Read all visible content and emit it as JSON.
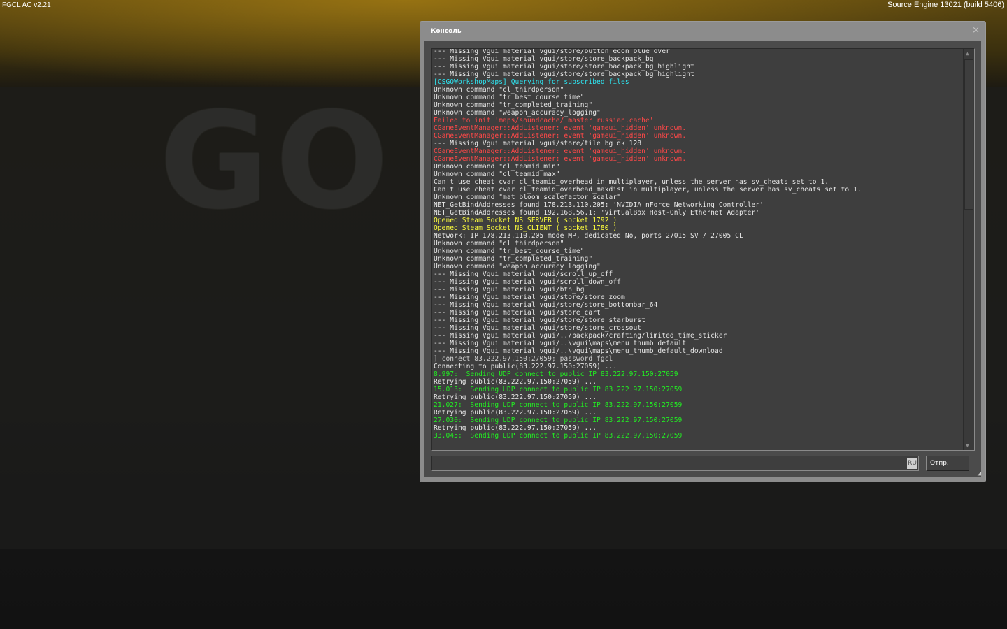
{
  "overlay": {
    "left": "FGCL AC v2.21",
    "right": "Source Engine 13021 (build 5406)",
    "logo": "GO"
  },
  "console": {
    "title": "Консоль",
    "close_icon": "×",
    "send_label": "Отпр.",
    "lang": "RU",
    "input_value": "",
    "colors": {
      "normal": "#e6e6e6",
      "cyan": "#2ee6f2",
      "red": "#ff4848",
      "yellow": "#ffff3c",
      "green": "#22ee22",
      "echo": "#cfcfcf"
    },
    "lines": [
      {
        "t": "--- Missing Vgui material vgui/store/button_econ_blue_over",
        "c": "normal"
      },
      {
        "t": "--- Missing Vgui material vgui/store/store_backpack_bg",
        "c": "normal"
      },
      {
        "t": "--- Missing Vgui material vgui/store/store_backpack_bg_highlight",
        "c": "normal"
      },
      {
        "t": "--- Missing Vgui material vgui/store/store_backpack_bg_highlight",
        "c": "normal"
      },
      {
        "t": "[CSGOWorkshopMaps] Querying for subscribed files",
        "c": "cyan"
      },
      {
        "t": "Unknown command \"cl_thirdperson\"",
        "c": "normal"
      },
      {
        "t": "Unknown command \"tr_best_course_time\"",
        "c": "normal"
      },
      {
        "t": "Unknown command \"tr_completed_training\"",
        "c": "normal"
      },
      {
        "t": "Unknown command \"weapon_accuracy_logging\"",
        "c": "normal"
      },
      {
        "t": "Failed to init 'maps/soundcache/_master_russian.cache'",
        "c": "red"
      },
      {
        "t": "CGameEventManager::AddListener: event 'gameui_hidden' unknown.",
        "c": "red"
      },
      {
        "t": "CGameEventManager::AddListener: event 'gameui_hidden' unknown.",
        "c": "red"
      },
      {
        "t": "--- Missing Vgui material vgui/store/tile_bg_dk_128",
        "c": "normal"
      },
      {
        "t": "CGameEventManager::AddListener: event 'gameui_hidden' unknown.",
        "c": "red"
      },
      {
        "t": "CGameEventManager::AddListener: event 'gameui_hidden' unknown.",
        "c": "red"
      },
      {
        "t": "Unknown command \"cl_teamid_min\"",
        "c": "normal"
      },
      {
        "t": "Unknown command \"cl_teamid_max\"",
        "c": "normal"
      },
      {
        "t": "Can't use cheat cvar cl_teamid_overhead in multiplayer, unless the server has sv_cheats set to 1.",
        "c": "normal"
      },
      {
        "t": "Can't use cheat cvar cl_teamid_overhead_maxdist in multiplayer, unless the server has sv_cheats set to 1.",
        "c": "normal"
      },
      {
        "t": "Unknown command \"mat_bloom_scalefactor_scalar\"",
        "c": "normal"
      },
      {
        "t": "NET_GetBindAddresses found 178.213.110.205: 'NVIDIA nForce Networking Controller'",
        "c": "normal"
      },
      {
        "t": "NET_GetBindAddresses found 192.168.56.1: 'VirtualBox Host-Only Ethernet Adapter'",
        "c": "normal"
      },
      {
        "t": "Opened Steam Socket NS_SERVER ( socket 1792 )",
        "c": "yellow"
      },
      {
        "t": "Opened Steam Socket NS_CLIENT ( socket 1780 )",
        "c": "yellow"
      },
      {
        "t": "Network: IP 178.213.110.205 mode MP, dedicated No, ports 27015 SV / 27005 CL",
        "c": "normal"
      },
      {
        "t": "Unknown command \"cl_thirdperson\"",
        "c": "normal"
      },
      {
        "t": "Unknown command \"tr_best_course_time\"",
        "c": "normal"
      },
      {
        "t": "Unknown command \"tr_completed_training\"",
        "c": "normal"
      },
      {
        "t": "Unknown command \"weapon_accuracy_logging\"",
        "c": "normal"
      },
      {
        "t": "--- Missing Vgui material vgui/scroll_up_off",
        "c": "normal"
      },
      {
        "t": "--- Missing Vgui material vgui/scroll_down_off",
        "c": "normal"
      },
      {
        "t": "--- Missing Vgui material vgui/btn_bg",
        "c": "normal"
      },
      {
        "t": "--- Missing Vgui material vgui/store/store_zoom",
        "c": "normal"
      },
      {
        "t": "--- Missing Vgui material vgui/store/store_bottombar_64",
        "c": "normal"
      },
      {
        "t": "--- Missing Vgui material vgui/store_cart",
        "c": "normal"
      },
      {
        "t": "--- Missing Vgui material vgui/store/store_starburst",
        "c": "normal"
      },
      {
        "t": "--- Missing Vgui material vgui/store/store_crossout",
        "c": "normal"
      },
      {
        "t": "--- Missing Vgui material vgui/../backpack/crafting/limited_time_sticker",
        "c": "normal"
      },
      {
        "t": "--- Missing Vgui material vgui/..\\vgui\\maps\\menu_thumb_default",
        "c": "normal"
      },
      {
        "t": "--- Missing Vgui material vgui/..\\vgui\\maps\\menu_thumb_default_download",
        "c": "normal"
      },
      {
        "t": "] connect 83.222.97.150:27059; password fgcl",
        "c": "echo"
      },
      {
        "t": "Connecting to public(83.222.97.150:27059) ...",
        "c": "normal"
      },
      {
        "t": "8.997:  Sending UDP connect to public IP 83.222.97.150:27059",
        "c": "green"
      },
      {
        "t": "Retrying public(83.222.97.150:27059) ...",
        "c": "normal"
      },
      {
        "t": "15.013:  Sending UDP connect to public IP 83.222.97.150:27059",
        "c": "green"
      },
      {
        "t": "Retrying public(83.222.97.150:27059) ...",
        "c": "normal"
      },
      {
        "t": "21.027:  Sending UDP connect to public IP 83.222.97.150:27059",
        "c": "green"
      },
      {
        "t": "Retrying public(83.222.97.150:27059) ...",
        "c": "normal"
      },
      {
        "t": "27.030:  Sending UDP connect to public IP 83.222.97.150:27059",
        "c": "green"
      },
      {
        "t": "Retrying public(83.222.97.150:27059) ...",
        "c": "normal"
      },
      {
        "t": "33.045:  Sending UDP connect to public IP 83.222.97.150:27059",
        "c": "green"
      }
    ]
  }
}
